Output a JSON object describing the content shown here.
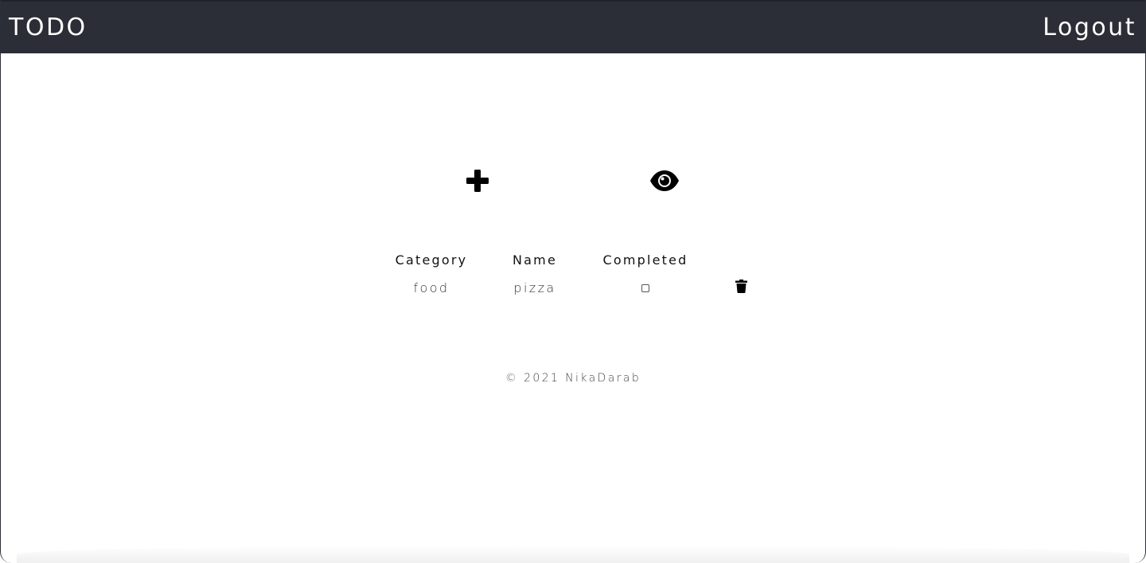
{
  "navbar": {
    "brand": "TODO",
    "logout_label": "Logout"
  },
  "actions": {
    "add_icon": "plus-icon",
    "view_icon": "eye-icon"
  },
  "table": {
    "headers": [
      "Category",
      "Name",
      "Completed"
    ],
    "rows": [
      {
        "category": "food",
        "name": "pizza",
        "completed": false,
        "delete_icon": "trash-icon"
      }
    ]
  },
  "footer": {
    "text": "© 2021 NikaDarab"
  },
  "colors": {
    "navbar_bg": "#2b2e36",
    "navbar_text": "#ffffff",
    "page_bg": "#ffffff"
  }
}
